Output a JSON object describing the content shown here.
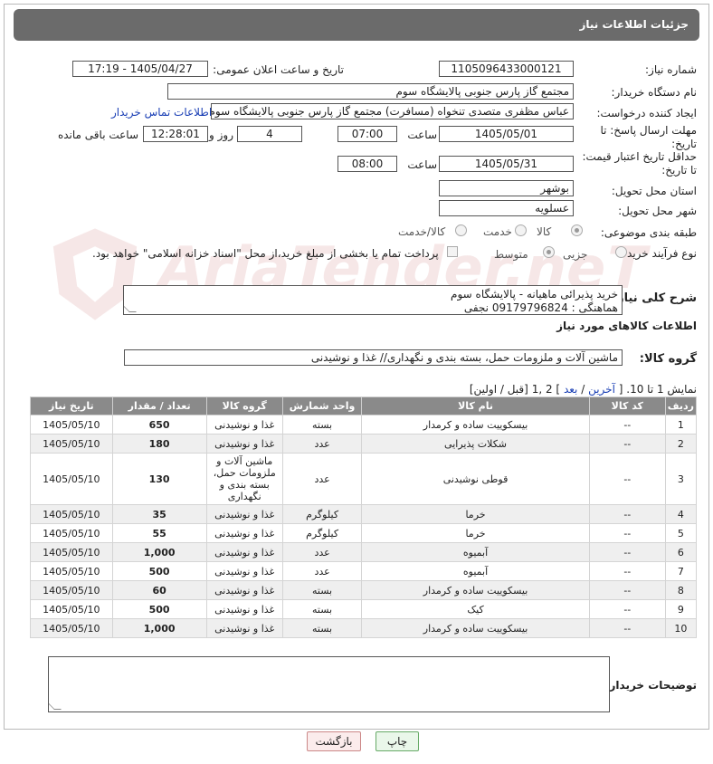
{
  "header": {
    "title": "جزئیات اطلاعات نیاز"
  },
  "form": {
    "need_number_label": "شماره نیاز:",
    "need_number": "1105096433000121",
    "announce_label": "تاریخ و ساعت اعلان عمومی:",
    "announce_value": "1405/04/27 - 17:19",
    "buyer_org_label": "نام دستگاه خریدار:",
    "buyer_org": "مجتمع گاز پارس جنوبی  پالایشگاه سوم",
    "creator_label": "ایجاد کننده درخواست:",
    "creator": "عباس مظفری متصدی تنخواه (مسافرت) مجتمع گاز پارس جنوبی  پالایشگاه سوم",
    "contact_link": "اطلاعات تماس خریدار",
    "reply_deadline_label": "مهلت ارسال پاسخ: تا تاریخ:",
    "reply_date": "1405/05/01",
    "time_label": "ساعت",
    "reply_time": "07:00",
    "days_value": "4",
    "days_label": "روز و",
    "remaining_time": "12:28:01",
    "remaining_label": "ساعت باقی مانده",
    "price_deadline_label": "حداقل تاریخ اعتبار قیمت: تا تاریخ:",
    "price_date": "1405/05/31",
    "price_time": "08:00",
    "province_label": "استان محل تحویل:",
    "province": "بوشهر",
    "city_label": "شهر محل تحویل:",
    "city": "عسلویه",
    "category_label": "طبقه بندی موضوعی:",
    "category_options": [
      "کالا",
      "خدمت",
      "کالا/خدمت"
    ],
    "purchase_type_label": "نوع فرآیند خرید :",
    "purchase_options": [
      "جزیی",
      "متوسط"
    ],
    "payment_note": "پرداخت تمام یا بخشی از مبلغ خرید،از محل \"اسناد خزانه اسلامی\" خواهد بود.",
    "desc_label": "شرح کلی نیاز:",
    "desc_line1": "خرید پذیرائی ماهیانه - پالایشگاه سوم",
    "desc_line2": "هماهنگی : 09179796824 نجفی",
    "goods_info_title": "اطلاعات کالاهای مورد نیاز",
    "goods_group_label": "گروه کالا:",
    "goods_group": "ماشین آلات و ملزومات حمل، بسته بندی و نگهداری// غذا و نوشیدنی"
  },
  "pagination": {
    "showing": "نمایش 1 تا 10. [",
    "last": "آخرین",
    "sep1": " / ",
    "next": "بعد",
    "pages": "] 2 ,1",
    "prev_first": "[قبل / اولین]"
  },
  "table": {
    "headers": [
      "ردیف",
      "کد کالا",
      "نام کالا",
      "واحد شمارش",
      "گروه کالا",
      "تعداد / مقدار",
      "تاریخ نیاز"
    ],
    "rows": [
      [
        "1",
        "--",
        "بیسکوییت ساده و کرمدار",
        "بسته",
        "غذا و نوشیدنی",
        "650",
        "1405/05/10"
      ],
      [
        "2",
        "--",
        "شکلات پذیرایی",
        "عدد",
        "غذا و نوشیدنی",
        "180",
        "1405/05/10"
      ],
      [
        "3",
        "--",
        "قوطی نوشیدنی",
        "عدد",
        "ماشین آلات و ملزومات حمل، بسته بندی و نگهداری",
        "130",
        "1405/05/10"
      ],
      [
        "4",
        "--",
        "خرما",
        "کیلوگرم",
        "غذا و نوشیدنی",
        "35",
        "1405/05/10"
      ],
      [
        "5",
        "--",
        "خرما",
        "کیلوگرم",
        "غذا و نوشیدنی",
        "55",
        "1405/05/10"
      ],
      [
        "6",
        "--",
        "آبمیوه",
        "عدد",
        "غذا و نوشیدنی",
        "1,000",
        "1405/05/10"
      ],
      [
        "7",
        "--",
        "آبمیوه",
        "عدد",
        "غذا و نوشیدنی",
        "500",
        "1405/05/10"
      ],
      [
        "8",
        "--",
        "بیسکوییت ساده و کرمدار",
        "بسته",
        "غذا و نوشیدنی",
        "60",
        "1405/05/10"
      ],
      [
        "9",
        "--",
        "کیک",
        "بسته",
        "غذا و نوشیدنی",
        "500",
        "1405/05/10"
      ],
      [
        "10",
        "--",
        "بیسکوییت ساده و کرمدار",
        "بسته",
        "غذا و نوشیدنی",
        "1,000",
        "1405/05/10"
      ]
    ]
  },
  "buyer_notes_label": "توضیحات خریدار:",
  "buttons": {
    "print": "چاپ",
    "back": "بازگشت"
  },
  "watermark_text": "AriaTender.neT"
}
